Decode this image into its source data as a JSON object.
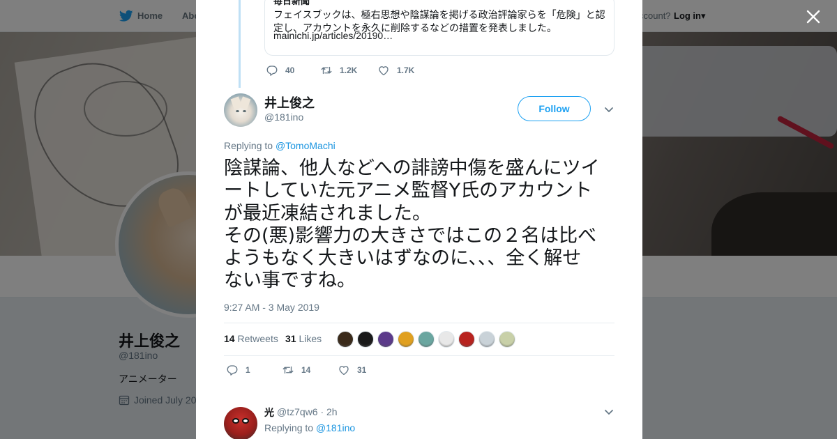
{
  "topnav": {
    "home_label": "Home",
    "about_label": "Abo",
    "account_label": "ccount?",
    "login_label": "Log in"
  },
  "profile": {
    "name": "井上俊之",
    "handle": "@181ino",
    "bio": "アニメーター",
    "joined": "Joined July 20"
  },
  "modal": {
    "quoted": {
      "author_partial": "毎日新聞",
      "text": "フェイスブックは、極右思想や陰謀論を掲げる政治評論家らを「危険」と認定し、アカウントを永久に削除するなどの措置を発表しました。",
      "link": "mainichi.jp/articles/20190…"
    },
    "parent_actions": {
      "replies": "40",
      "retweets": "1.2K",
      "likes": "1.7K"
    },
    "tweet": {
      "name": "井上俊之",
      "handle": "@181ino",
      "follow_label": "Follow",
      "replying_prefix": "Replying to",
      "replying_user": "@TomoMachi",
      "text": "陰謀論、他人などへの誹謗中傷を盛んにツイ\nートしていた元アニメ監督Y氏のアカウント\nが最近凍結されました。\nその(悪)影響力の大きさではこの２名は比べ\nようもなく大きいはずなのに、、、全く解せ\nない事ですね。",
      "timestamp": "9:27 AM - 3 May 2019",
      "retweets_count": "14",
      "retweets_label": "Retweets",
      "likes_count": "31",
      "likes_label": "Likes",
      "likers": [
        {
          "name": "liker-1",
          "color": "#3a2a1a"
        },
        {
          "name": "liker-2",
          "color": "#1a1a1a"
        },
        {
          "name": "liker-3",
          "color": "#5b3a8a"
        },
        {
          "name": "liker-4",
          "color": "#e0a020"
        },
        {
          "name": "liker-5",
          "color": "#6aa6a0"
        },
        {
          "name": "liker-6",
          "color": "#e8e8e8"
        },
        {
          "name": "liker-7",
          "color": "#b8231f"
        },
        {
          "name": "liker-8",
          "color": "#c9d2d8"
        },
        {
          "name": "liker-9",
          "color": "#c8d0a8"
        }
      ],
      "actions": {
        "replies": "1",
        "retweets": "14",
        "likes": "31"
      }
    },
    "reply": {
      "name": "光",
      "meta": " @tz7qw6 · 2h",
      "replying_prefix": "Replying to",
      "replying_user": "@181ino"
    }
  },
  "colors": {
    "accent": "#1da1f2",
    "link": "#1b95e0",
    "muted": "#657786",
    "thread_line": "#bfe0f5"
  }
}
